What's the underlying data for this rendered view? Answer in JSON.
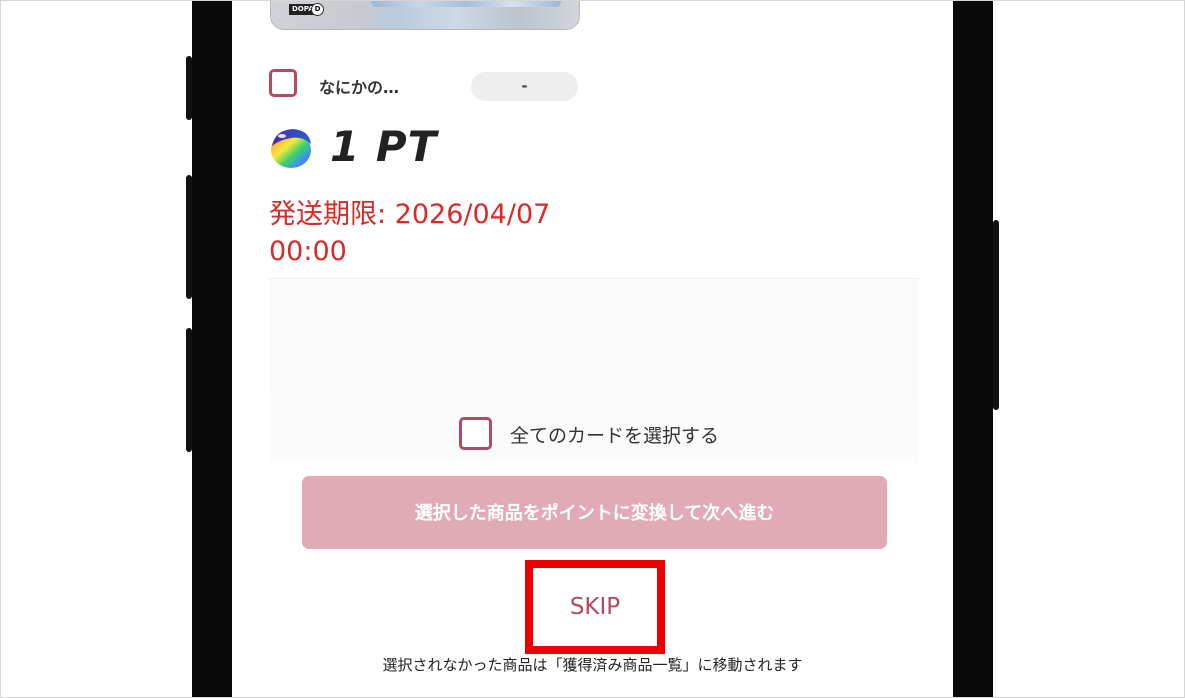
{
  "item": {
    "label": "なにかの…",
    "value": "-"
  },
  "points": {
    "value": "1 PT",
    "icon": "rainbow-coin-icon"
  },
  "deadline": {
    "text": "発送期限: 2026/04/07",
    "time": "00:00"
  },
  "select_all": {
    "label": "全てのカードを選択する"
  },
  "convert_button": {
    "label": "選択した商品をポイントに変換して次へ進む"
  },
  "skip": {
    "label": "SKIP"
  },
  "note": {
    "text": "選択されなかった商品は「獲得済み商品一覧」に移動されます"
  },
  "card": {
    "logo": "DOPA",
    "badge": "D"
  },
  "colors": {
    "accent": "#b34a63",
    "button_disabled": "#e0abb6",
    "deadline": "#d92a2a",
    "highlight": "#ee0000"
  }
}
